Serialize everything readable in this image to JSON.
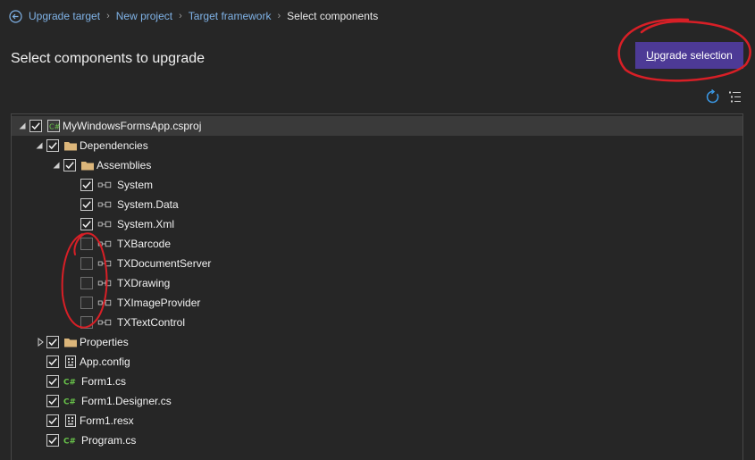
{
  "breadcrumb": {
    "items": [
      "Upgrade target",
      "New project",
      "Target framework"
    ],
    "separator": "›",
    "current": "Select components"
  },
  "page": {
    "title": "Select components to upgrade"
  },
  "toolbar": {
    "upgrade_label_first": "U",
    "upgrade_label_rest": "pgrade selection",
    "refresh_icon": "refresh-icon",
    "options_icon": "list-options-icon"
  },
  "colors": {
    "accent": "#4d3a96",
    "link": "#7fb2e6",
    "annotation": "#d81f26",
    "csharp": "#68c24a",
    "folder": "#dcb67a"
  },
  "tree": [
    {
      "label": "MyWindowsFormsApp.csproj",
      "icon": "csharp-project-icon",
      "checked": true,
      "expanded": true
    },
    {
      "label": "Dependencies",
      "icon": "folder-icon",
      "checked": true,
      "expanded": true
    },
    {
      "label": "Assemblies",
      "icon": "folder-icon",
      "checked": true,
      "expanded": true
    },
    {
      "label": "System",
      "icon": "reference-icon",
      "checked": true
    },
    {
      "label": "System.Data",
      "icon": "reference-icon",
      "checked": true
    },
    {
      "label": "System.Xml",
      "icon": "reference-icon",
      "checked": true
    },
    {
      "label": "TXBarcode",
      "icon": "reference-icon",
      "checked": false
    },
    {
      "label": "TXDocumentServer",
      "icon": "reference-icon",
      "checked": false
    },
    {
      "label": "TXDrawing",
      "icon": "reference-icon",
      "checked": false
    },
    {
      "label": "TXImageProvider",
      "icon": "reference-icon",
      "checked": false
    },
    {
      "label": "TXTextControl",
      "icon": "reference-icon",
      "checked": false
    },
    {
      "label": "Properties",
      "icon": "folder-icon",
      "checked": true,
      "expanded": false
    },
    {
      "label": "App.config",
      "icon": "config-file-icon",
      "checked": true
    },
    {
      "label": "Form1.cs",
      "icon": "csharp-file-icon",
      "checked": true
    },
    {
      "label": "Form1.Designer.cs",
      "icon": "csharp-file-icon",
      "checked": true
    },
    {
      "label": "Form1.resx",
      "icon": "resource-file-icon",
      "checked": true
    },
    {
      "label": "Program.cs",
      "icon": "csharp-file-icon",
      "checked": true
    }
  ]
}
